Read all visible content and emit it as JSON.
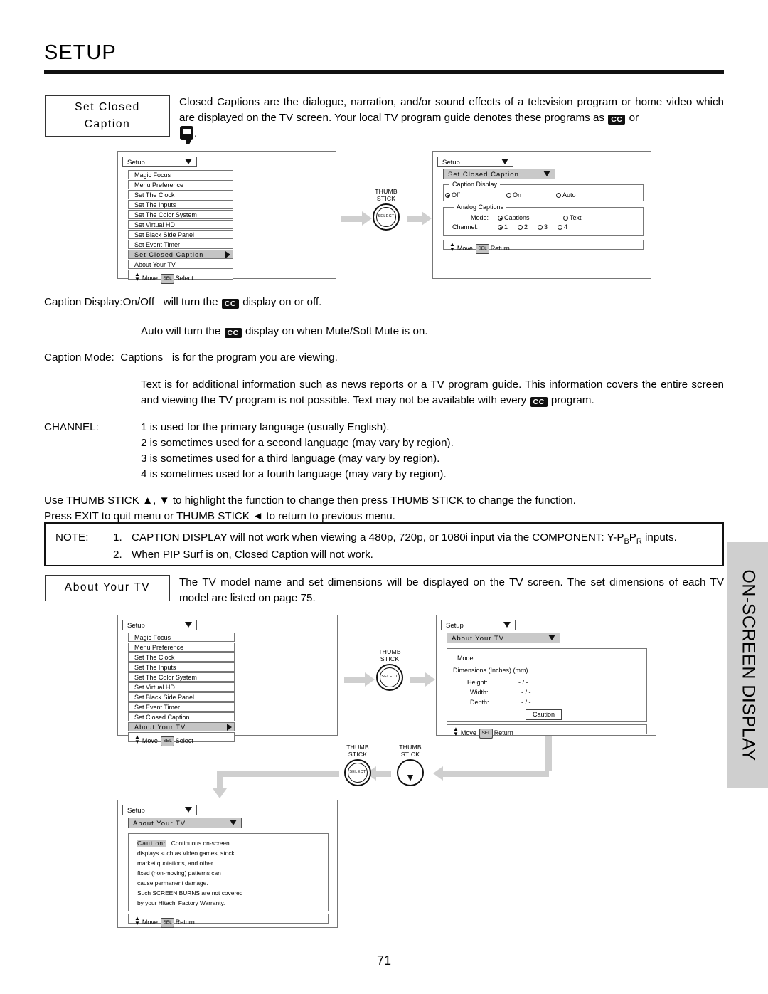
{
  "page": {
    "title": "SETUP",
    "number": "71",
    "side_tab": "ON-SCREEN DISPLAY"
  },
  "sections": {
    "closed_caption": {
      "label_line1": "Set  Closed",
      "label_line2": "Caption",
      "intro_1": "Closed Captions are the dialogue, narration, and/or sound effects of a television program or home video",
      "intro_2": "which are displayed on the TV screen.  Your local TV program guide denotes these programs as",
      "intro_3": "or",
      "intro_4": ".",
      "cc_badge": "CC"
    },
    "about_your_tv": {
      "label": "About  Your  TV",
      "text": "The TV model name and set dimensions will be displayed on the TV screen.  The set dimensions of each TV model are listed on page 75."
    }
  },
  "explanations": {
    "caption_display_label": "Caption Display:On/Off",
    "caption_display_text_a": "will turn the",
    "caption_display_text_b": "display on or off.",
    "auto_label": "Auto",
    "auto_text_a": "will turn the",
    "auto_text_b": "display on when Mute/Soft Mute is on.",
    "caption_mode_label": "Caption Mode:",
    "captions_label": "Captions",
    "captions_text": "is for the program you are viewing.",
    "text_label": "Text",
    "text_line1_a": "is for additional information such as news reports or a TV program guide.  This information covers the entire",
    "text_line2_a": "screen and viewing the TV program is not possible.  Text may not be available with every",
    "text_line2_b": "program.",
    "channel_label": "CHANNEL:",
    "channel_lines": [
      "1 is used for the primary language (usually English).",
      "2 is sometimes used for a second language (may vary by region).",
      "3 is sometimes used for a third language (may vary by region).",
      "4 is sometimes used for a fourth language (may vary by region)."
    ],
    "usage_line1": "Use THUMB STICK ▲, ▼ to highlight the function to change then press THUMB STICK to change the function.",
    "usage_line2": "Press EXIT to quit menu or THUMB STICK ◄ to return to previous menu."
  },
  "note": {
    "label": "NOTE:",
    "item1_num": "1.",
    "item1_a": "CAPTION DISPLAY will not work when viewing a 480p, 720p, or 1080i input via the COMPONENT: Y-P",
    "item1_sub1": "B",
    "item1_b": "P",
    "item1_sub2": "R",
    "item1_c": " inputs.",
    "item2_num": "2.",
    "item2": "When PIP Surf is on, Closed Caption will not work."
  },
  "setup_menu": {
    "title": "Setup",
    "items": [
      "Magic Focus",
      "Menu Preference",
      "Set The Clock",
      "Set The Inputs",
      "Set The Color System",
      "Set Virtual HD",
      "Set Black Side Panel",
      "Set Event Timer"
    ],
    "item_cc": "Set  Closed  Caption",
    "item_about": "About Your TV",
    "item_cc_plain": "Set Closed Caption",
    "item_about_hl": "About  Your  TV",
    "footer_move": "Move",
    "footer_sel": "SEL",
    "footer_select": "Select",
    "footer_return": "Return"
  },
  "cc_screen": {
    "title": "Setup",
    "subtitle": "Set  Closed  Caption",
    "caption_display": {
      "legend": "Caption Display",
      "options": [
        "Off",
        "On",
        "Auto"
      ],
      "selected": "Off"
    },
    "analog_captions": {
      "legend": "Analog Captions",
      "mode_label": "Mode:",
      "mode_options": [
        "Captions",
        "Text"
      ],
      "mode_selected": "Captions",
      "channel_label": "Channel:",
      "channel_options": [
        "1",
        "2",
        "3",
        "4"
      ],
      "channel_selected": "1"
    }
  },
  "about_screen": {
    "title": "Setup",
    "subtitle": "About  Your  TV",
    "model_label": "Model:",
    "dimensions_label": "Dimensions  (Inches) (mm)",
    "rows": [
      {
        "label": "Height:",
        "value": "- / -"
      },
      {
        "label": "Width:",
        "value": "- / -"
      },
      {
        "label": "Depth:",
        "value": "- / -"
      }
    ],
    "caution_button": "Caution"
  },
  "caution_screen": {
    "title": "Setup",
    "subtitle": "About  Your  TV",
    "keyword": "Caution:",
    "lines": [
      "Continuous  on-screen",
      "displays such as Video games, stock",
      "market  quotations,  and  other",
      "fixed  (non-moving)  patterns  can",
      "cause permanent damage.",
      "Such  SCREEN BURNS  are not covered",
      "by your Hitachi Factory Warranty."
    ]
  },
  "thumb_stick": {
    "line1": "THUMB",
    "line2": "STICK",
    "select": "SELECT"
  }
}
